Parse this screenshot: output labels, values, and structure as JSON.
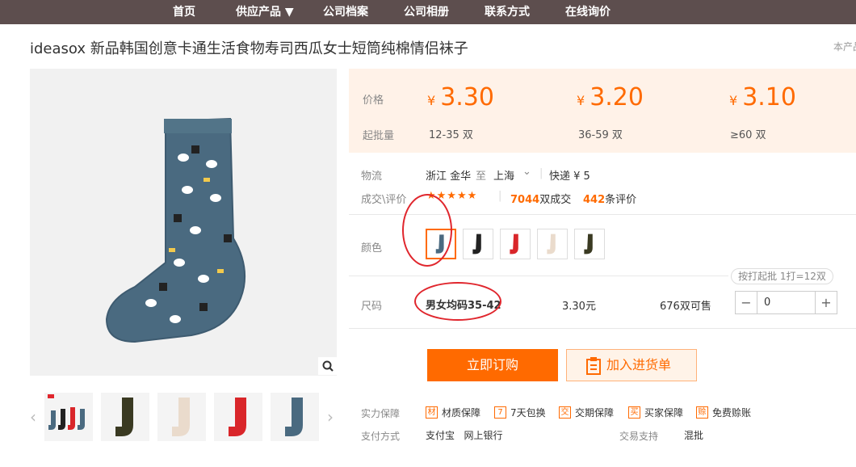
{
  "nav": {
    "items": [
      "首页",
      "供应产品 ▼",
      "公司档案",
      "公司相册",
      "联系方式",
      "在线询价"
    ]
  },
  "product": {
    "title": "ideasox 新品韩国创意卡通生活食物寿司西瓜女士短筒纯棉情侣袜子",
    "note_right": "本产品"
  },
  "price": {
    "price_label": "价格",
    "qty_label": "起批量",
    "currency": "¥",
    "tiers": [
      {
        "price": "3.30",
        "qty": "12-35 双"
      },
      {
        "price": "3.20",
        "qty": "36-59 双"
      },
      {
        "price": "3.10",
        "qty": "≥60 双"
      }
    ]
  },
  "logistics": {
    "label": "物流",
    "from": "浙江 金华",
    "to_word": "至",
    "to": "上海",
    "shipping": "快递 ¥ 5"
  },
  "trade": {
    "label": "成交\\评价",
    "stars": "★★★★★",
    "deals_num": "7044",
    "deals_suffix": "双成交",
    "reviews_num": "442",
    "reviews_suffix": "条评价"
  },
  "color": {
    "label": "颜色",
    "options": [
      {
        "name": "blue",
        "hex": "#4a6a80"
      },
      {
        "name": "black",
        "hex": "#222222"
      },
      {
        "name": "red",
        "hex": "#d9262a"
      },
      {
        "name": "beige",
        "hex": "#eadbcc"
      },
      {
        "name": "olive",
        "hex": "#3a3a22"
      }
    ],
    "selected": 0
  },
  "size": {
    "label": "尺码",
    "value": "男女均码35-42",
    "price": "3.30元",
    "stock": "676双可售",
    "hint": "按打起批 1打=12双",
    "quantity": "0",
    "minus": "−",
    "plus": "+"
  },
  "actions": {
    "buy": "立即订购",
    "cart": "加入进货单"
  },
  "guarantee": {
    "label": "实力保障",
    "items": [
      {
        "icon": "材",
        "text": "材质保障"
      },
      {
        "icon": "7",
        "text": "7天包换"
      },
      {
        "icon": "交",
        "text": "交期保障"
      },
      {
        "icon": "买",
        "text": "买家保障"
      },
      {
        "icon": "赊",
        "text": "免费赊账"
      }
    ]
  },
  "payment": {
    "label": "支付方式",
    "methods": "支付宝   网上银行",
    "support_label": "交易支持",
    "support": "混批"
  },
  "colors": {
    "accent": "#ff6a00",
    "nav_bg": "#5d4e4e",
    "price_bg": "#fff2e8",
    "annotation_red": "#e0262d"
  }
}
